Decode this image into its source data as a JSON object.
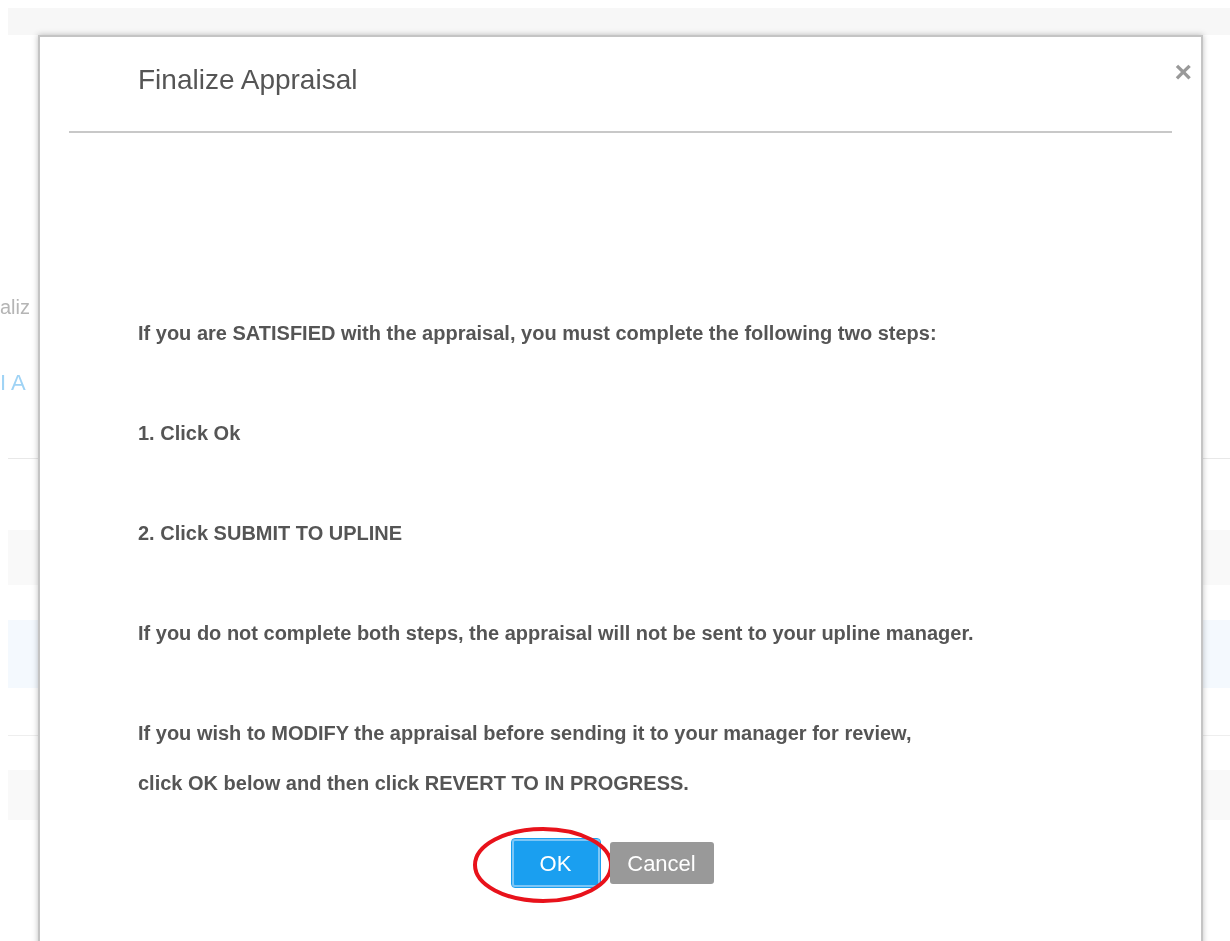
{
  "background": {
    "texts": [
      {
        "text": "aliz",
        "kind": "label"
      },
      {
        "text": "I A",
        "kind": "link"
      }
    ]
  },
  "dialog": {
    "title": "Finalize Appraisal",
    "close": "×",
    "paragraphs": [
      {
        "lines": [
          "If you are SATISFIED with the appraisal, you must complete the following two steps:"
        ]
      },
      {
        "lines": [
          "1. Click Ok"
        ]
      },
      {
        "lines": [
          "2. Click SUBMIT TO UPLINE"
        ]
      },
      {
        "lines": [
          "If you do not complete both steps, the appraisal will not be sent to your upline manager."
        ]
      },
      {
        "lines": [
          "If you wish to MODIFY the appraisal before sending it to your manager for review,",
          "click OK below and then click REVERT TO IN PROGRESS."
        ]
      }
    ],
    "buttons": [
      {
        "label": "OK",
        "kind": "primary",
        "highlighted": true
      },
      {
        "label": "Cancel",
        "kind": "secondary",
        "highlighted": false
      }
    ]
  }
}
